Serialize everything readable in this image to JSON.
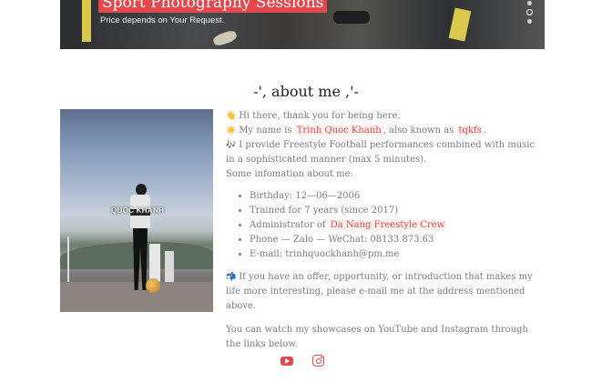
{
  "hero": {
    "title": "Sport Photography Sessions",
    "subtitle": "Price depends on Your Request.",
    "slides": 3,
    "active_slide": 2
  },
  "about": {
    "title": "-', about me ,'-",
    "photo_label": "QUỐC KHÁNH",
    "greeting_icon": "👋",
    "greeting": "Hi there, thank you for being here.",
    "name_icon": "☀️",
    "name_prefix": "My name is",
    "name": "Trinh Quoc Khanh",
    "alias_prefix": ", also known as",
    "alias": "tqkfs",
    "alias_suffix": ".",
    "perf_icon": "🎶",
    "perf_text": "I provide Freestyle Football performances combined with music in a sophisticated manner (max 5 minutes).",
    "info_intro": "Some infomation about me:",
    "info": {
      "birthday": "Birthday: 12—06—2006",
      "trained": "Trained for 7 years (since 2017)",
      "admin_prefix": "Administrator of",
      "admin_link": "Da Nang Freestyle Crew",
      "phone": "Phone — Zalo — WeChat: 08133.873.63",
      "email": "E-mail: trinhquockhanh@pm.me"
    },
    "offer_icon": "📬",
    "offer_text": "If you have an offer, opportunity, or introduction that makes my life more interesting, please e-mail me at the address mentioned above.",
    "showcase_text": "You can watch my showcases on YouTube and Instagram through the links below."
  },
  "social": {
    "youtube_icon": "youtube-icon",
    "instagram_icon": "instagram-icon"
  },
  "colors": {
    "accent": "#e2484c",
    "text": "#7a7a7a",
    "heading": "#1f1f1f"
  }
}
